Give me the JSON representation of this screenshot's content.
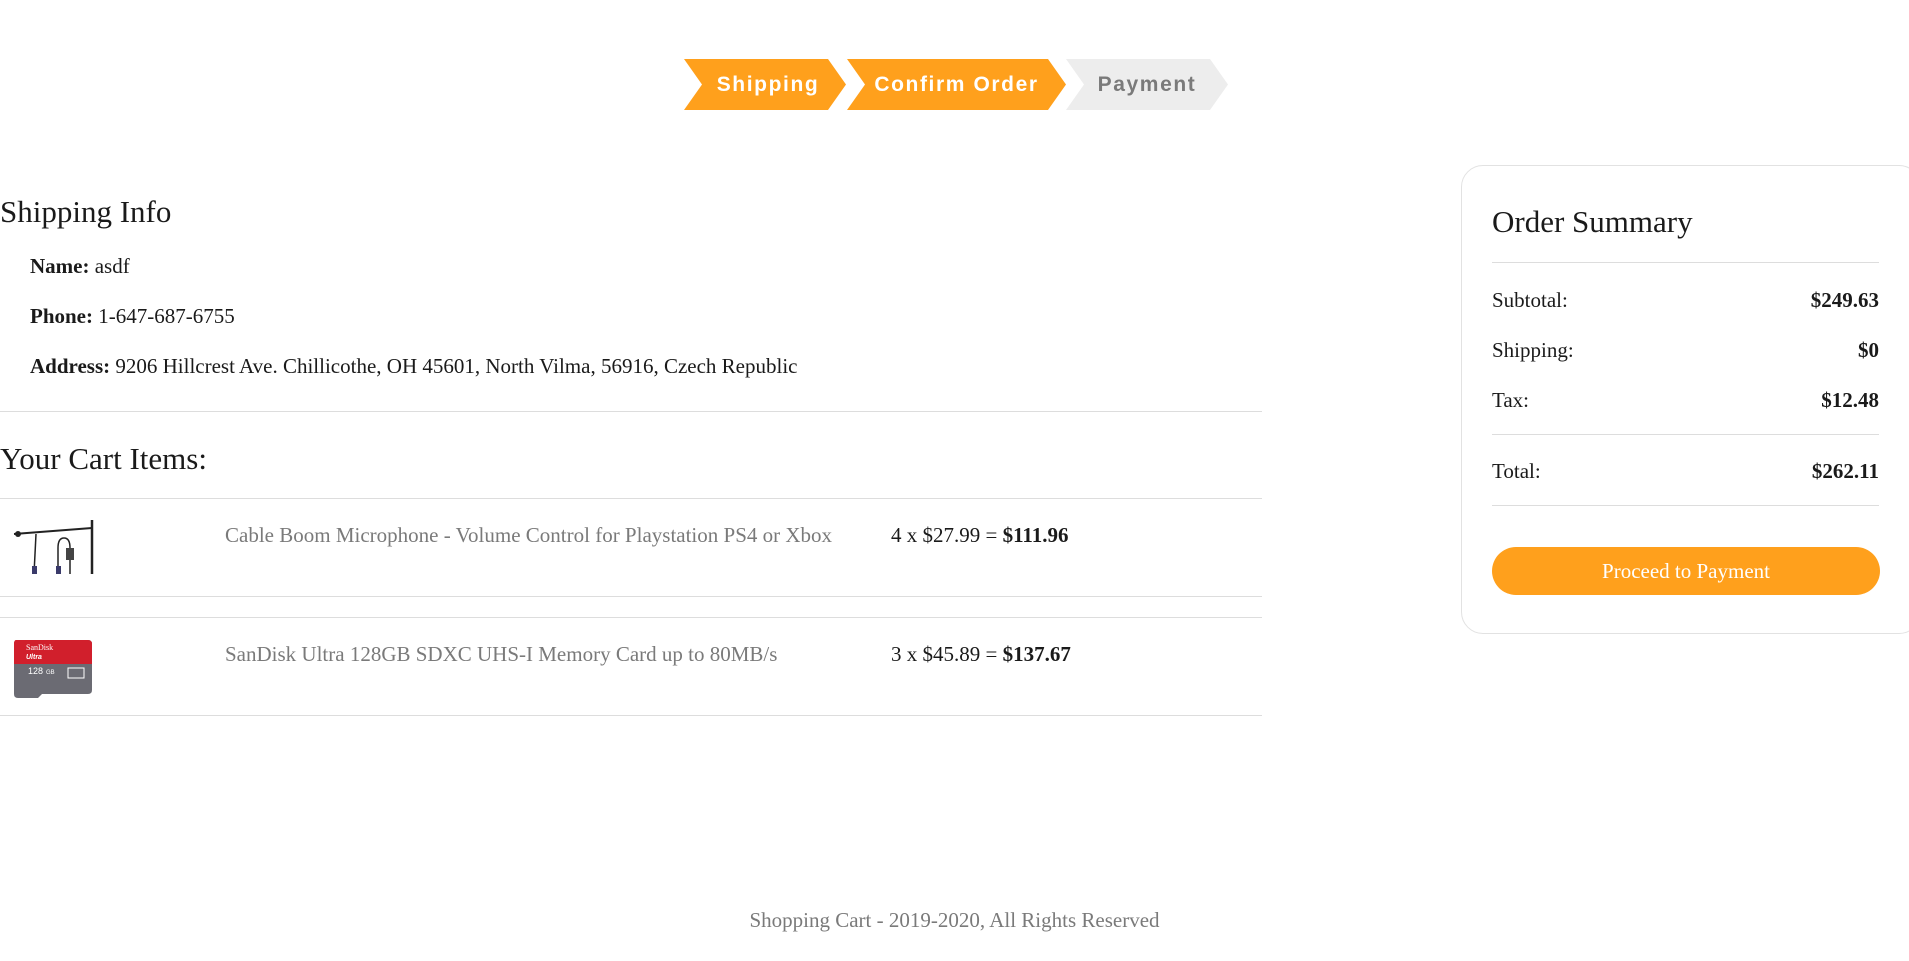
{
  "stepper": {
    "steps": [
      {
        "label": "Shipping",
        "state": "active"
      },
      {
        "label": "Confirm Order",
        "state": "active"
      },
      {
        "label": "Payment",
        "state": "inactive"
      }
    ]
  },
  "shipping_info": {
    "title": "Shipping Info",
    "name_label": "Name:",
    "name_value": "asdf",
    "phone_label": "Phone:",
    "phone_value": "1-647-687-6755",
    "address_label": "Address:",
    "address_value": "9206 Hillcrest Ave. Chillicothe, OH 45601, North Vilma, 56916, Czech Republic"
  },
  "cart": {
    "title": "Your Cart Items:",
    "items": [
      {
        "name": "Cable Boom Microphone - Volume Control for Playstation PS4 or Xbox",
        "qty_price": "4 x $27.99 = ",
        "line_total": "$111.96",
        "image": "microphone-cable"
      },
      {
        "name": "SanDisk Ultra 128GB SDXC UHS-I Memory Card up to 80MB/s",
        "qty_price": "3 x $45.89 = ",
        "line_total": "$137.67",
        "image": "sd-card"
      }
    ]
  },
  "summary": {
    "title": "Order Summary",
    "subtotal_label": "Subtotal:",
    "subtotal_value": "$249.63",
    "shipping_label": "Shipping:",
    "shipping_value": "$0",
    "tax_label": "Tax:",
    "tax_value": "$12.48",
    "total_label": "Total:",
    "total_value": "$262.11",
    "button_label": "Proceed to Payment"
  },
  "footer": {
    "text": "Shopping Cart - 2019-2020, All Rights Reserved"
  },
  "colors": {
    "accent": "#ffa01c",
    "inactive_step": "#ededed",
    "muted_text": "#7a7a7a"
  },
  "sdcard_text": {
    "brand": "SanDisk",
    "line": "Ultra",
    "capacity": "128",
    "unit": "GB"
  }
}
